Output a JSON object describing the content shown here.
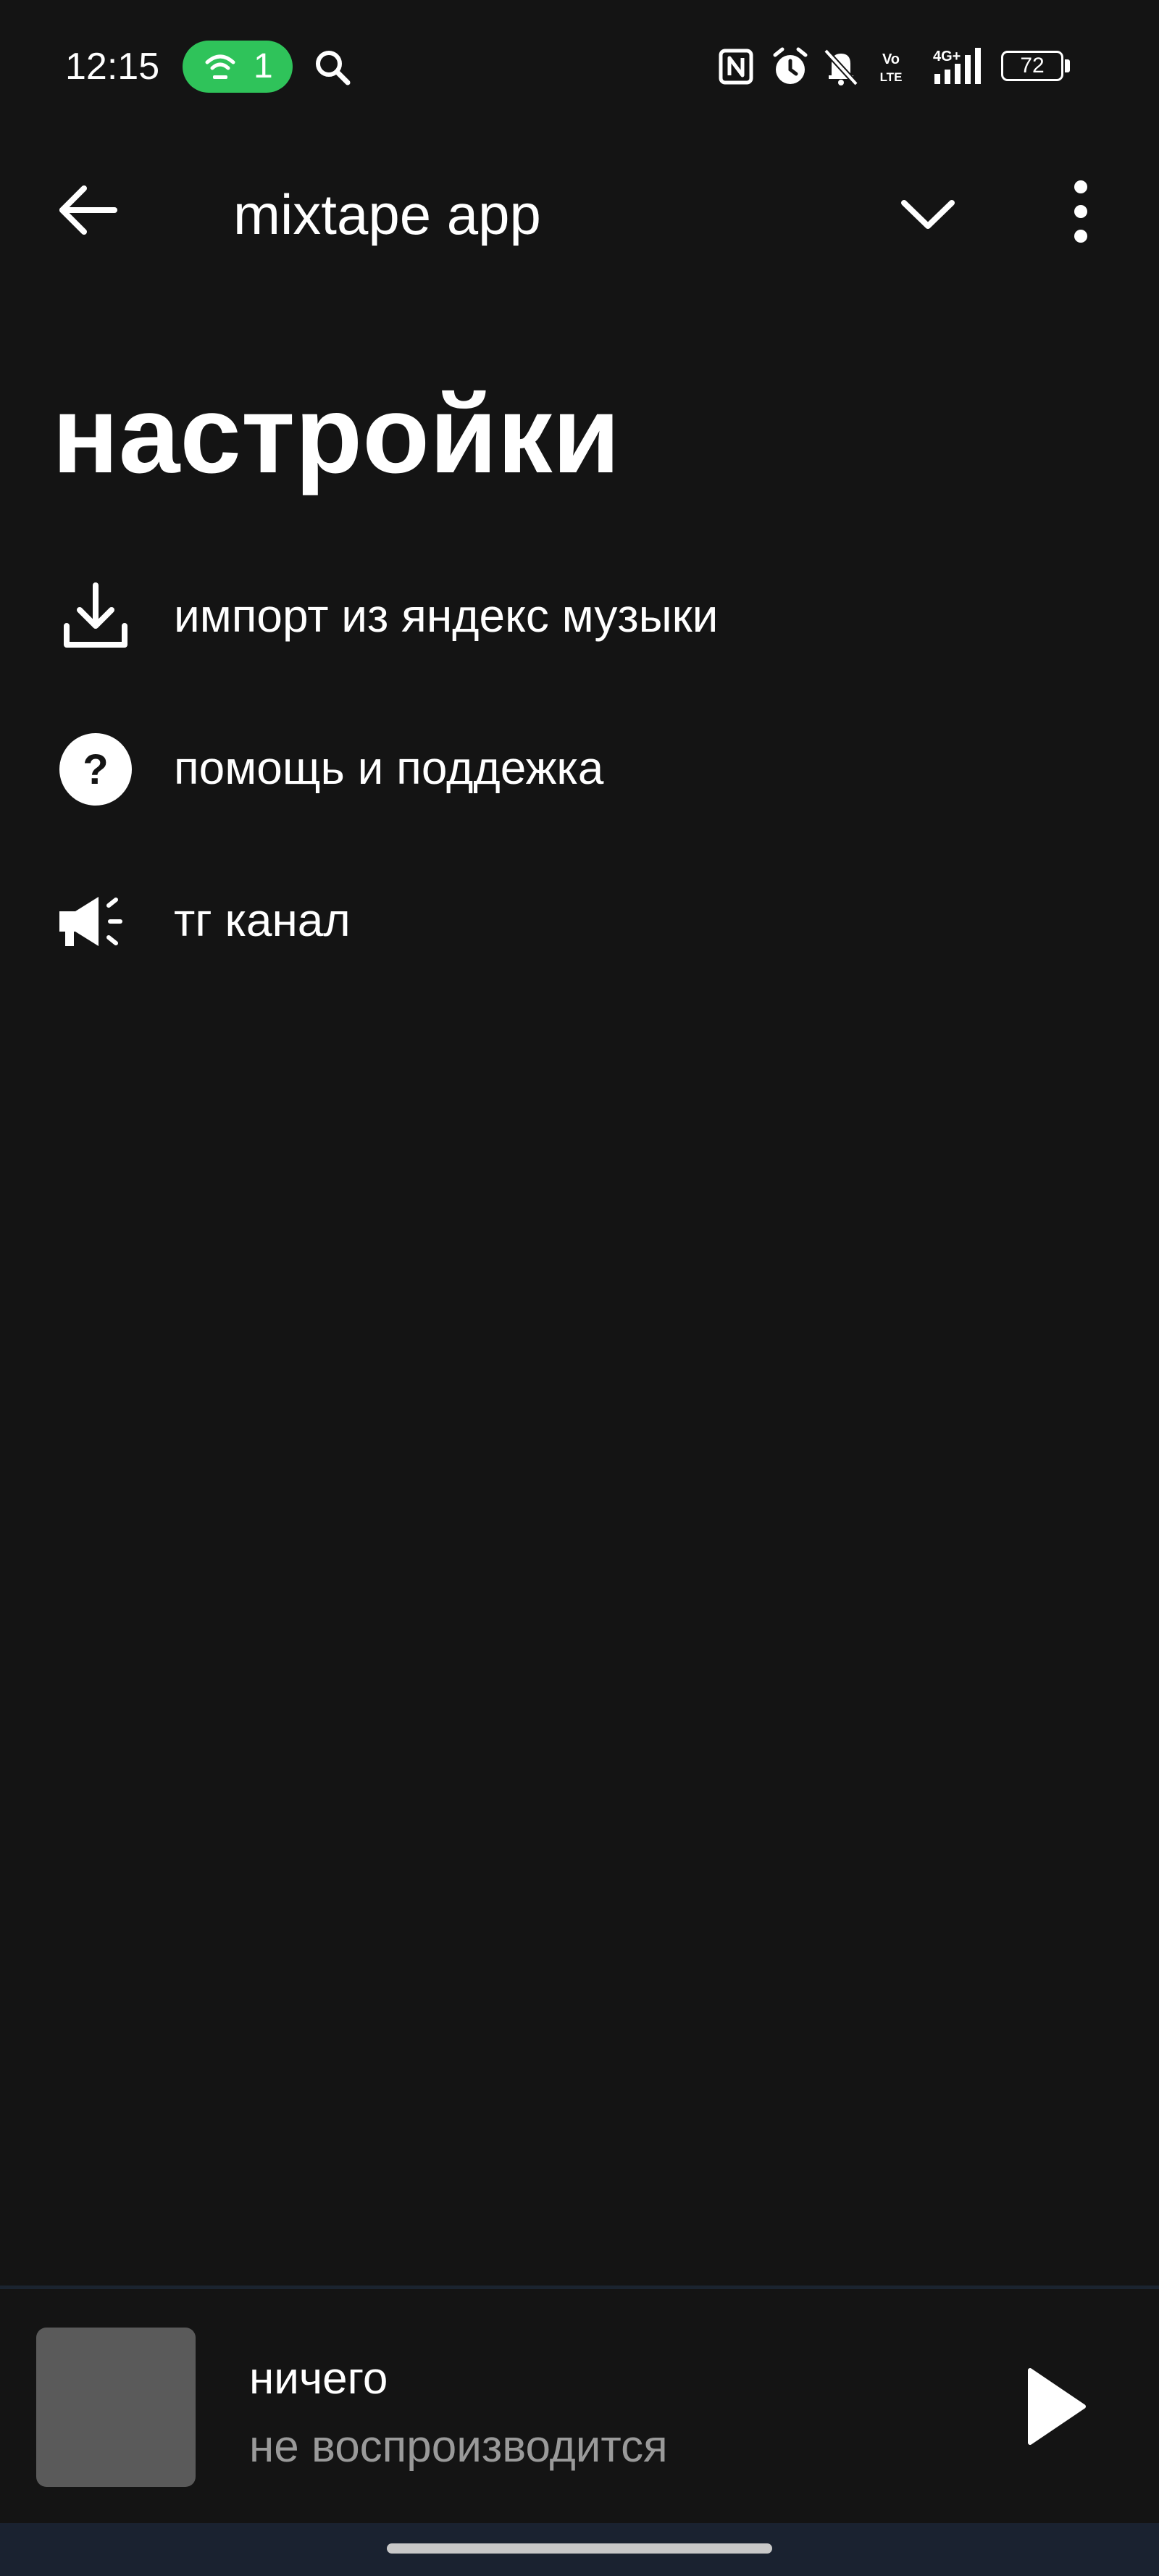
{
  "status_bar": {
    "time": "12:15",
    "hotspot_count": "1",
    "battery_level": "72",
    "icons": [
      "hotspot-icon",
      "search-icon",
      "nfc-icon",
      "alarm-icon",
      "mute-icon",
      "volte-icon",
      "signal-4g-icon",
      "battery-icon"
    ]
  },
  "app_bar": {
    "title": "mixtape app",
    "back_icon": "arrow-left-icon",
    "expand_icon": "chevron-down-icon",
    "more_icon": "more-vertical-icon"
  },
  "settings": {
    "title": "настройки",
    "items": [
      {
        "label": "импорт из яндекс музыки",
        "icon": "download-icon"
      },
      {
        "label": "помощь и поддежка",
        "icon": "help-circle-icon"
      },
      {
        "label": "тг канал",
        "icon": "megaphone-icon"
      }
    ]
  },
  "player": {
    "title": "ничего",
    "subtitle": "не воспроизводится",
    "play_icon": "play-icon"
  },
  "colors": {
    "background": "#141414",
    "hotspot_green": "#2fc35a",
    "artwork_placeholder": "#5a5a5a",
    "subtitle_gray": "#9a9a9a",
    "nav_bar": "#1a2230"
  }
}
